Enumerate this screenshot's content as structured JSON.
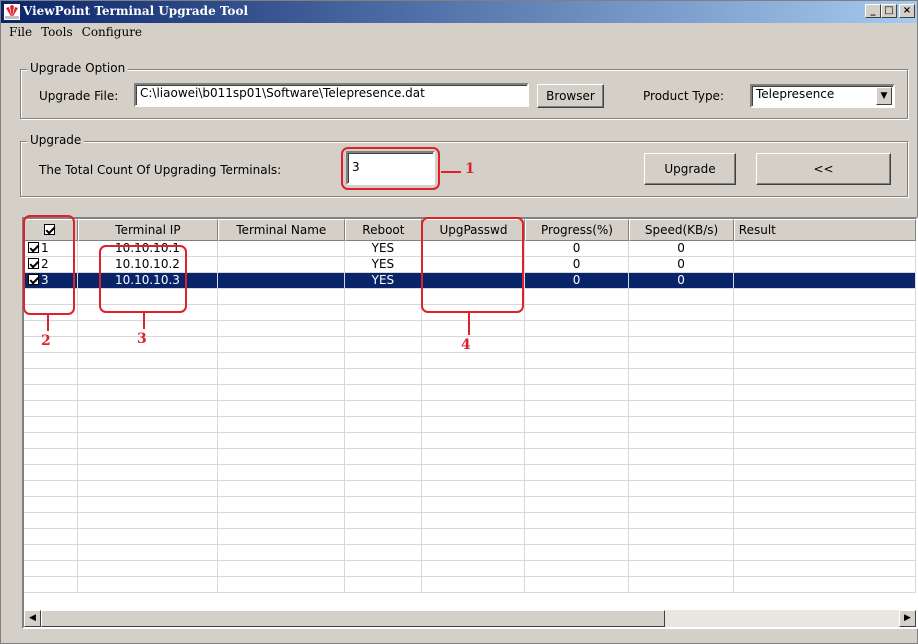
{
  "window": {
    "title": "ViewPoint Terminal Upgrade Tool",
    "minimize_glyph": "_",
    "maximize_glyph": "□",
    "close_glyph": "×"
  },
  "menu": [
    "File",
    "Tools",
    "Configure"
  ],
  "upgrade_option": {
    "legend": "Upgrade Option",
    "file_label": "Upgrade File:",
    "file_value": "C:\\liaowei\\b011sp01\\Software\\Telepresence.dat",
    "browser_label": "Browser",
    "product_type_label": "Product Type:",
    "product_type_value": "Telepresence"
  },
  "upgrade": {
    "legend": "Upgrade",
    "count_label": "The Total Count Of Upgrading Terminals:",
    "count_value": "3",
    "upgrade_label": "Upgrade",
    "collapse_label": "<<"
  },
  "table": {
    "columns": [
      "",
      "Terminal IP",
      "Terminal Name",
      "Reboot",
      "UpgPasswd",
      "Progress(%)",
      "Speed(KB/s)",
      "Result"
    ],
    "rows": [
      {
        "index": "1",
        "ip": "10.10.10.1",
        "name": "",
        "reboot": "YES",
        "passwd": "",
        "progress": "0",
        "speed": "0",
        "result": ""
      },
      {
        "index": "2",
        "ip": "10.10.10.2",
        "name": "",
        "reboot": "YES",
        "passwd": "",
        "progress": "0",
        "speed": "0",
        "result": ""
      },
      {
        "index": "3",
        "ip": "10.10.10.3",
        "name": "",
        "reboot": "YES",
        "passwd": "",
        "progress": "0",
        "speed": "0",
        "result": ""
      }
    ],
    "selected_row": 3
  },
  "annotations": [
    "1",
    "2",
    "3",
    "4"
  ],
  "colors": {
    "annotation": "#e0202a",
    "title_bar": "#0a246a",
    "selection": "#0a246a"
  }
}
